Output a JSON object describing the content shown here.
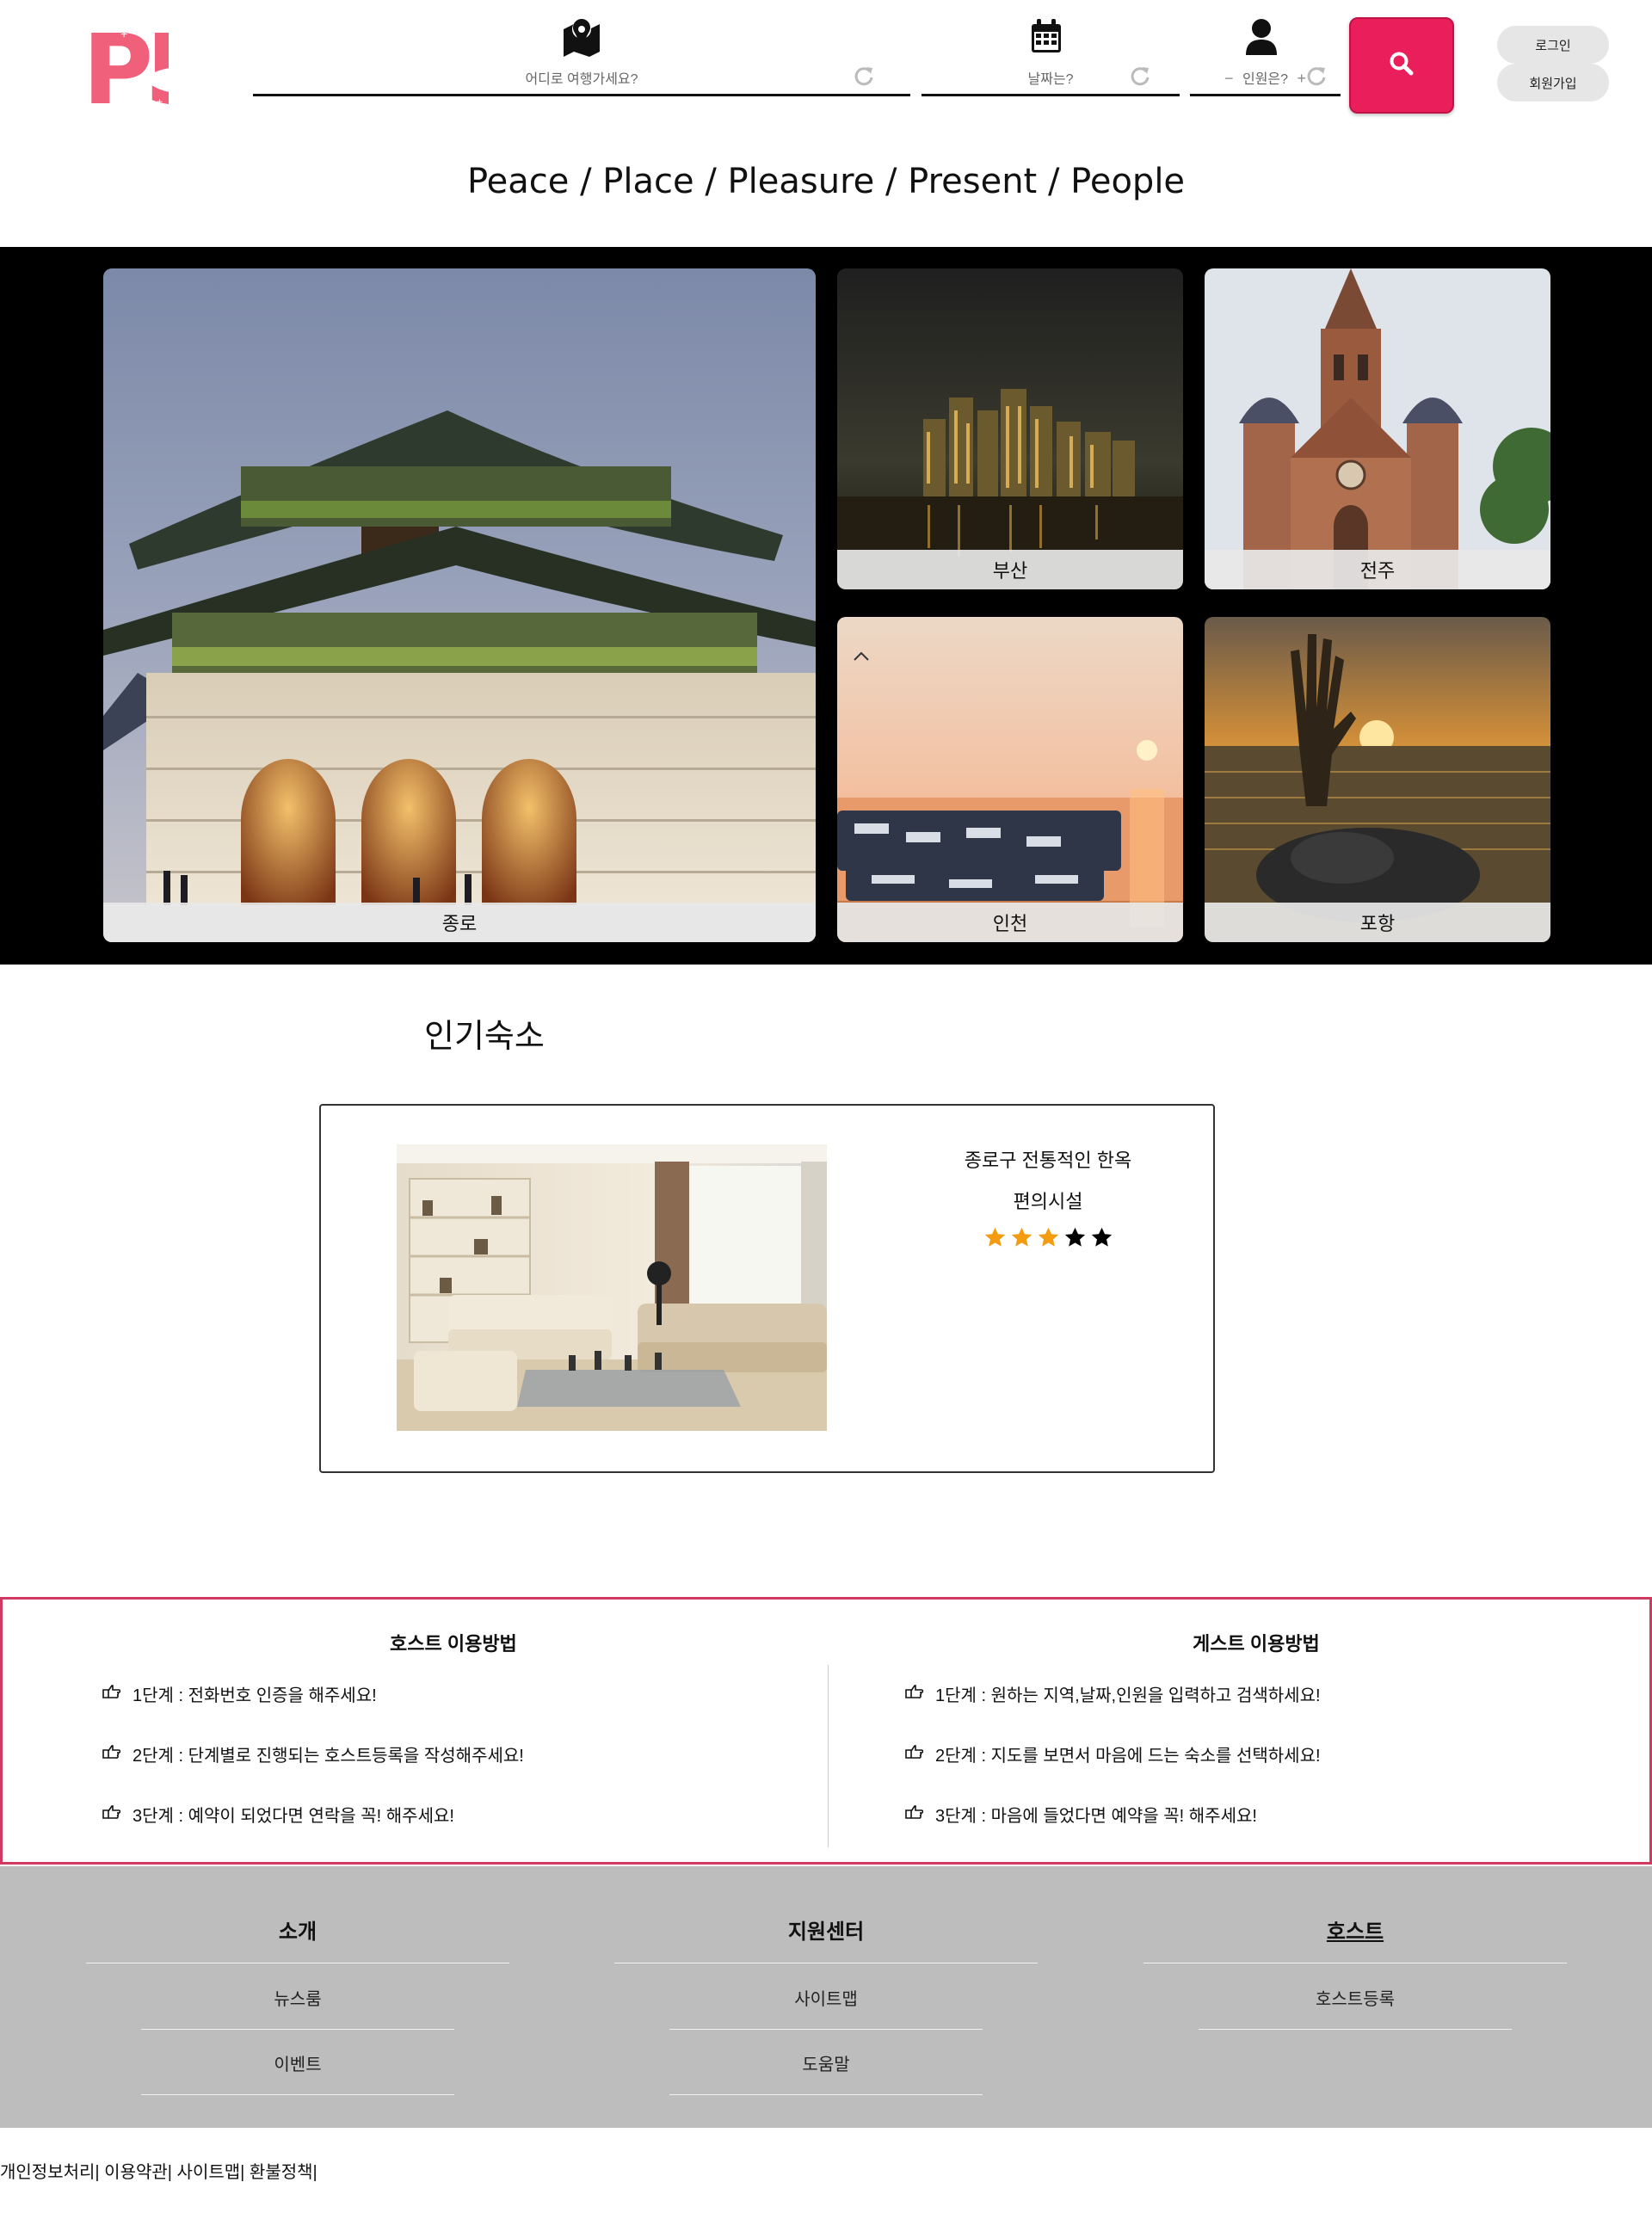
{
  "brand": {
    "logo_text": "P5",
    "accent": "#e91e5a",
    "logo_color": "#f0607a"
  },
  "search": {
    "where_placeholder": "어디로 여행가세요?",
    "date_placeholder": "날짜는?",
    "people_placeholder": "인원은?",
    "minus": "−",
    "plus": "+"
  },
  "auth": {
    "login": "로그인",
    "signup": "회원가입"
  },
  "tagline": "Peace / Place / Pleasure / Present / People",
  "destinations": [
    {
      "name": "종로"
    },
    {
      "name": "부산"
    },
    {
      "name": "전주"
    },
    {
      "name": "인천"
    },
    {
      "name": "포항"
    }
  ],
  "popular": {
    "title": "인기숙소",
    "card": {
      "name": "종로구 전통적인 한옥",
      "amenities": "편의시설",
      "rating": 3,
      "rating_max": 5,
      "star_color_on": "#f39c12",
      "star_color_off": "#000000"
    }
  },
  "howto": {
    "host": {
      "title": "호스트 이용방법",
      "steps": [
        "1단계 : 전화번호 인증을 해주세요!",
        "2단계 : 단계별로 진행되는 호스트등록을 작성해주세요!",
        "3단계 : 예약이 되었다면 연락을 꼭! 해주세요!"
      ]
    },
    "guest": {
      "title": "게스트 이용방법",
      "steps": [
        "1단계 : 원하는 지역,날짜,인원을 입력하고 검색하세요!",
        "2단계 : 지도를 보면서 마음에 드는 숙소를 선택하세요!",
        "3단계 : 마음에 들었다면 예약을 꼭! 해주세요!"
      ]
    },
    "border_color": "#d03a62"
  },
  "footer": {
    "intro": {
      "title": "소개",
      "links": [
        "뉴스룸",
        "이벤트"
      ]
    },
    "support": {
      "title": "지원센터",
      "links": [
        "사이트맵",
        "도움말"
      ]
    },
    "host": {
      "title": "호스트",
      "links": [
        "호스트등록"
      ]
    }
  },
  "bottom_links": [
    "개인정보처리",
    "이용약관",
    "사이트맵",
    "환불정책"
  ]
}
